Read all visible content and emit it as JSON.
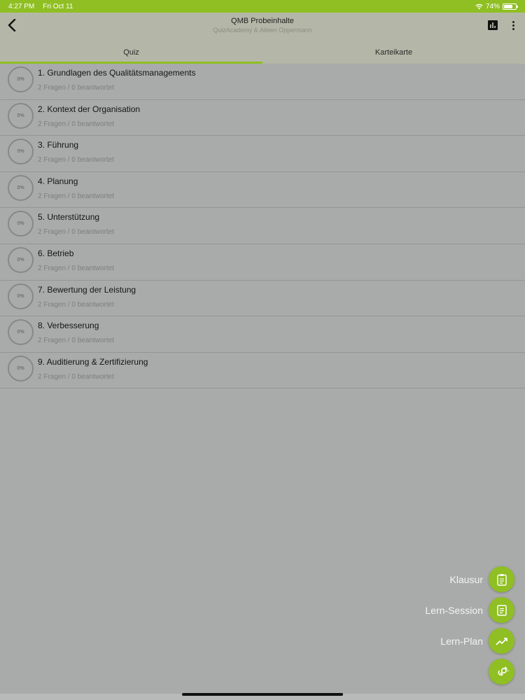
{
  "status_bar": {
    "time": "4:27 PM",
    "date": "Fri Oct 11",
    "battery": "74%",
    "battery_level": 0.74,
    "wifi_icon": "wifi-icon"
  },
  "header": {
    "title": "QMB Probeinhalte",
    "subtitle": "QuizAcademy & Aileen Oppermann",
    "back_icon": "chevron-left-icon",
    "stats_icon": "bar-chart-icon",
    "more_icon": "more-vertical-icon"
  },
  "tabs": [
    {
      "label": "Quiz",
      "active": true
    },
    {
      "label": "Karteikarte",
      "active": false
    }
  ],
  "chapters": [
    {
      "title": "1. Grundlagen des Qualitätsmanagements",
      "progress": "0%",
      "sub": "2 Fragen / 0 beantwortet"
    },
    {
      "title": "2. Kontext der Organisation",
      "progress": "0%",
      "sub": "2 Fragen / 0 beantwortet"
    },
    {
      "title": "3. Führung",
      "progress": "0%",
      "sub": "2 Fragen / 0 beantwortet"
    },
    {
      "title": "4. Planung",
      "progress": "0%",
      "sub": "2 Fragen / 0 beantwortet"
    },
    {
      "title": "5. Unterstützung",
      "progress": "0%",
      "sub": "2 Fragen / 0 beantwortet"
    },
    {
      "title": "6. Betrieb",
      "progress": "0%",
      "sub": "2 Fragen / 0 beantwortet"
    },
    {
      "title": "7. Bewertung der Leistung",
      "progress": "0%",
      "sub": "2 Fragen / 0 beantwortet"
    },
    {
      "title": "8. Verbesserung",
      "progress": "0%",
      "sub": "2 Fragen / 0 beantwortet"
    },
    {
      "title": "9. Auditierung & Zertifizierung",
      "progress": "0%",
      "sub": "2 Fragen / 0 beantwortet"
    }
  ],
  "fab_menu": [
    {
      "label": "Klausur",
      "icon": "clipboard-icon"
    },
    {
      "label": "Lern-Session",
      "icon": "notes-icon"
    },
    {
      "label": "Lern-Plan",
      "icon": "trending-up-icon"
    }
  ],
  "fab_main": {
    "icon": "go-icon"
  },
  "colors": {
    "accent": "#8fbf22",
    "overlay_bg": "#a9aaaa"
  }
}
